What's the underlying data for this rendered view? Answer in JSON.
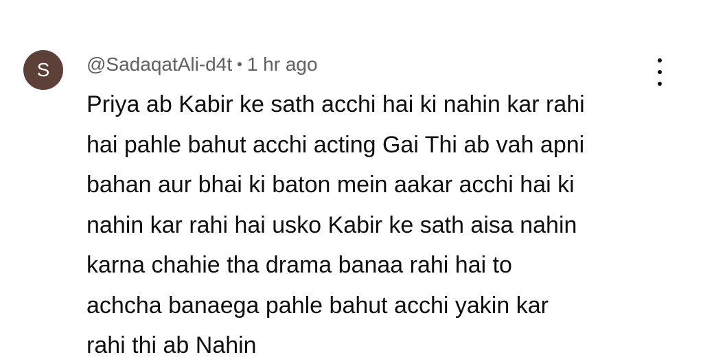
{
  "comment": {
    "avatar_letter": "S",
    "avatar_color": "#5d4037",
    "author": "@SadaqatAli-d4t",
    "separator": "•",
    "time": "1 hr ago",
    "menu_icon": "more-vert-icon",
    "lines": [
      "Priya ab Kabir ke sath acchi hai ki nahin kar rahi",
      "hai pahle bahut acchi acting Gai Thi ab vah apni",
      "bahan aur bhai ki baton mein aakar acchi hai ki",
      "nahin kar rahi hai usko Kabir ke sath aisa nahin",
      "karna chahie tha drama banaa rahi hai to",
      "achcha banaega pahle bahut acchi yakin kar",
      "rahi thi ab Nahin"
    ]
  }
}
